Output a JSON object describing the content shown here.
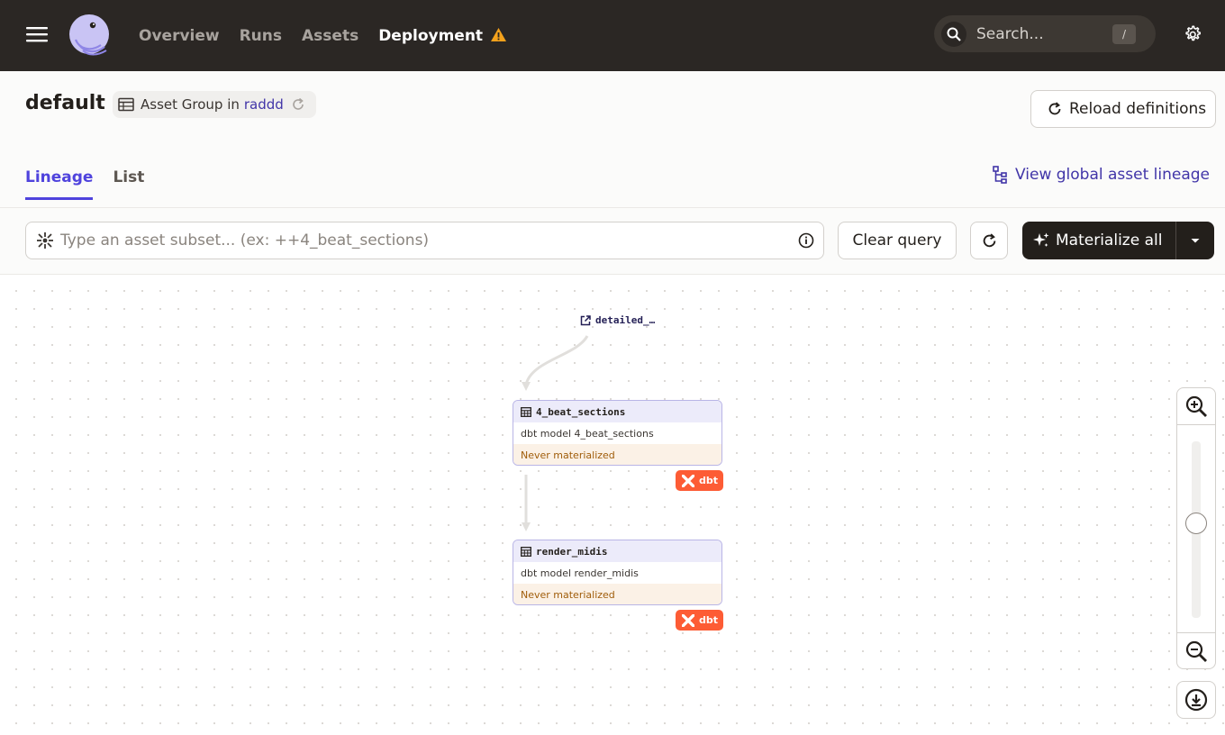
{
  "nav": {
    "links": [
      "Overview",
      "Runs",
      "Assets",
      "Deployment"
    ],
    "active": "Deployment",
    "search_placeholder": "Search...",
    "search_shortcut": "/"
  },
  "header": {
    "title": "default",
    "group_label": "Asset Group in",
    "group_location": "raddd",
    "reload_label": "Reload definitions"
  },
  "tabs": [
    {
      "label": "Lineage",
      "active": true
    },
    {
      "label": "List",
      "active": false
    }
  ],
  "global_lineage_label": "View global asset lineage",
  "toolbar": {
    "query_placeholder": "Type an asset subset... (ex: ++4_beat_sections)",
    "clear_label": "Clear query",
    "materialize_label": "Materialize all"
  },
  "graph": {
    "external_asset": "detailed_…",
    "nodes": [
      {
        "name": "4_beat_sections",
        "description": "dbt model 4_beat_sections",
        "status": "Never materialized",
        "badge": "dbt"
      },
      {
        "name": "render_midis",
        "description": "dbt model render_midis",
        "status": "Never materialized",
        "badge": "dbt"
      }
    ]
  },
  "colors": {
    "nav_bg": "#2b2724",
    "accent": "#4f43dd",
    "dbt": "#fd5c35",
    "status_warning": "#a05d0a"
  }
}
